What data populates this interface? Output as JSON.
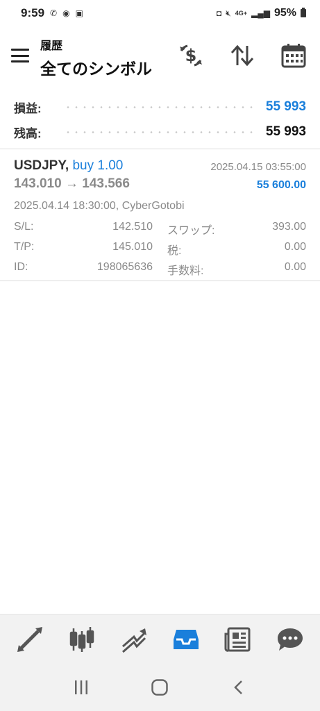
{
  "status_bar": {
    "time": "9:59",
    "battery": "95%",
    "network": "4G+"
  },
  "header": {
    "subtitle": "履歴",
    "title": "全てのシンボル"
  },
  "summary": {
    "profit_label": "損益:",
    "profit_value": "55 993",
    "balance_label": "残高:",
    "balance_value": "55 993"
  },
  "trade": {
    "symbol": "USDJPY,",
    "type": "buy 1.00",
    "close_time": "2025.04.15 03:55:00",
    "price_open": "143.010",
    "arrow": "→",
    "price_close": "143.566",
    "profit": "55 600.00",
    "open_info": "2025.04.14 18:30:00, CyberGotobi",
    "details": [
      {
        "k1": "S/L:",
        "v1": "142.510",
        "k2": "スワップ:",
        "v2": "393.00"
      },
      {
        "k1": "T/P:",
        "v1": "145.010",
        "k2": "税:",
        "v2": "0.00"
      },
      {
        "k1": "ID:",
        "v1": "198065636",
        "k2": "手数料:",
        "v2": "0.00"
      }
    ]
  },
  "tabs": [
    {
      "icon": "trade-arrows-icon"
    },
    {
      "icon": "candlestick-chart-icon"
    },
    {
      "icon": "trend-lines-icon"
    },
    {
      "icon": "history-inbox-icon",
      "active": true
    },
    {
      "icon": "news-icon"
    },
    {
      "icon": "chat-icon"
    }
  ],
  "colors": {
    "accent": "#1a7fdb",
    "text_muted": "#8a8a8a",
    "icon_dark": "#444444"
  }
}
